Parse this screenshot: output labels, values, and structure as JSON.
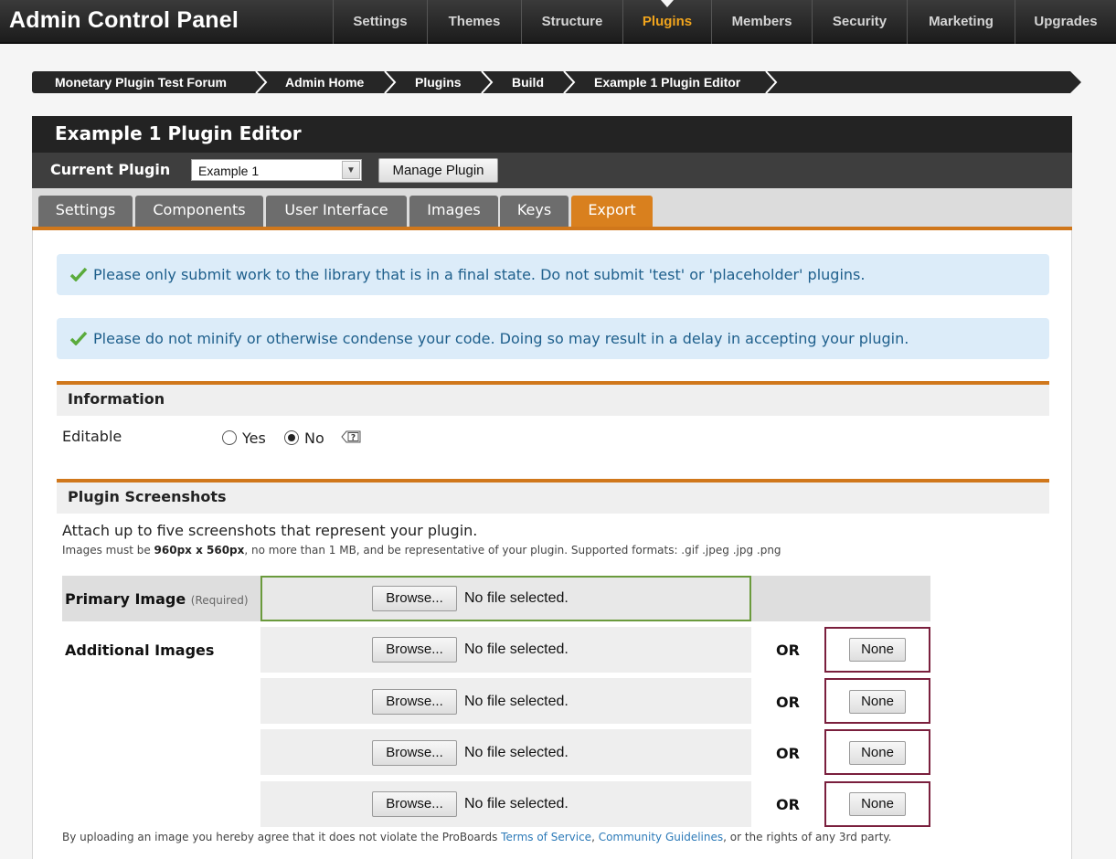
{
  "app": {
    "title": "Admin Control Panel"
  },
  "topnav": [
    {
      "label": "Settings",
      "active": false
    },
    {
      "label": "Themes",
      "active": false
    },
    {
      "label": "Structure",
      "active": false
    },
    {
      "label": "Plugins",
      "active": true
    },
    {
      "label": "Members",
      "active": false
    },
    {
      "label": "Security",
      "active": false
    },
    {
      "label": "Marketing",
      "active": false
    },
    {
      "label": "Upgrades",
      "active": false
    }
  ],
  "breadcrumb": [
    "Monetary Plugin Test Forum",
    "Admin Home",
    "Plugins",
    "Build",
    "Example 1 Plugin Editor"
  ],
  "editor": {
    "title": "Example 1 Plugin Editor",
    "current_plugin_label": "Current Plugin",
    "current_plugin_value": "Example 1",
    "manage_button": "Manage Plugin",
    "tabs": [
      {
        "label": "Settings",
        "active": false
      },
      {
        "label": "Components",
        "active": false
      },
      {
        "label": "User Interface",
        "active": false
      },
      {
        "label": "Images",
        "active": false
      },
      {
        "label": "Keys",
        "active": false
      },
      {
        "label": "Export",
        "active": true
      }
    ]
  },
  "notices": [
    "Please only submit work to the library that is in a final state. Do not submit 'test' or 'placeholder' plugins.",
    "Please do not minify or otherwise condense your code. Doing so may result in a delay in accepting your plugin."
  ],
  "information": {
    "heading": "Information",
    "editable_label": "Editable",
    "yes_label": "Yes",
    "no_label": "No",
    "selected": "No"
  },
  "screenshots": {
    "heading": "Plugin Screenshots",
    "intro": "Attach up to five screenshots that represent your plugin.",
    "note_prefix": "Images must be ",
    "note_size": "960px x 560px",
    "note_suffix": ", no more than 1 MB, and be representative of your plugin. Supported formats: .gif .jpeg .jpg .png",
    "primary_label": "Primary Image",
    "primary_required": "(Required)",
    "additional_label": "Additional Images",
    "browse_label": "Browse...",
    "no_file": "No file selected.",
    "or_label": "OR",
    "none_label": "None",
    "footer_prefix": "By uploading an image you hereby agree that it does not violate the ProBoards ",
    "tos_link": "Terms of Service",
    "footer_comma": ", ",
    "guidelines_link": "Community Guidelines",
    "footer_suffix": ", or the rights of any 3rd party."
  },
  "colors": {
    "accent": "#d0771b",
    "active_nav": "#f0a41d",
    "notice_bg": "#dcecf9",
    "notice_text": "#1e5f8c"
  }
}
